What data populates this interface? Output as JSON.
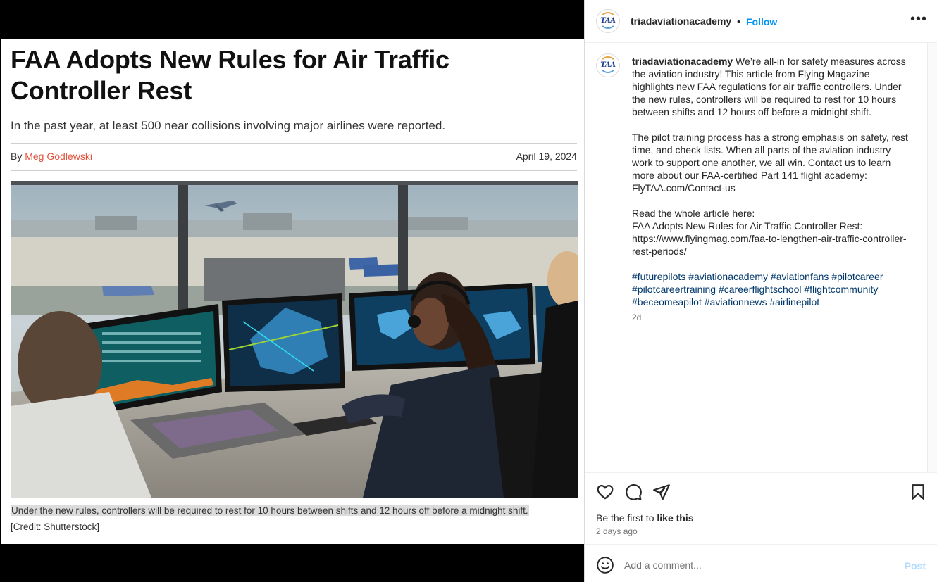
{
  "article": {
    "headline": "FAA Adopts New Rules for Air Traffic Controller Rest",
    "subhead": "In the past year, at least 500 near collisions involving major airlines were reported.",
    "by": "By ",
    "author": "Meg Godlewski",
    "date": "April 19, 2024",
    "caption": "Under the new rules, controllers will be required to rest for 10 hours between shifts and 12 hours off before a midnight shift.",
    "credit": "[Credit: Shutterstock]"
  },
  "post": {
    "username": "triadaviationacademy",
    "separator": "•",
    "follow_label": "Follow",
    "more_label": "•••",
    "avatar_text": "TAA",
    "caption_username": "triadaviationacademy",
    "caption_p1": " We’re all-in for safety measures across the aviation industry! This article from Flying Magazine highlights new FAA regulations for air traffic controllers. Under the new rules, controllers will be required to rest for 10 hours between shifts and 12 hours off before a midnight shift.",
    "caption_p2": "The pilot training process has a strong emphasis on safety, rest time, and check lists. When all parts of the aviation industry work to support one another, we all win. Contact us to learn more about our FAA-certified Part 141 flight academy: FlyTAA.com/Contact-us",
    "caption_p3_line1": "Read the whole article here:",
    "caption_p3_line2": "FAA Adopts New Rules for Air Traffic Controller Rest:",
    "caption_p3_line3": "https://www.flyingmag.com/faa-to-lengthen-air-traffic-controller-rest-periods/",
    "hashtags": [
      "#futurepilots",
      "#aviationacademy",
      "#aviationfans",
      "#pilotcareer",
      "#pilotcareertraining",
      "#careerflightschool",
      "#flightcommunity",
      "#beceomeapilot",
      "#aviationnews",
      "#airlinepilot"
    ],
    "caption_time": "2d",
    "likes_prefix": "Be the first to ",
    "likes_action": "like this",
    "posted_ago": "2 days ago",
    "comment_placeholder": "Add a comment...",
    "post_label": "Post"
  },
  "colors": {
    "accent": "#0095f6",
    "author_link": "#e0533d",
    "hashtag": "#00376b",
    "post_disabled": "#b3dbff"
  },
  "icons": [
    "like-heart-icon",
    "comment-bubble-icon",
    "share-paper-plane-icon",
    "save-bookmark-icon",
    "emoji-smiley-icon",
    "more-options-icon"
  ]
}
